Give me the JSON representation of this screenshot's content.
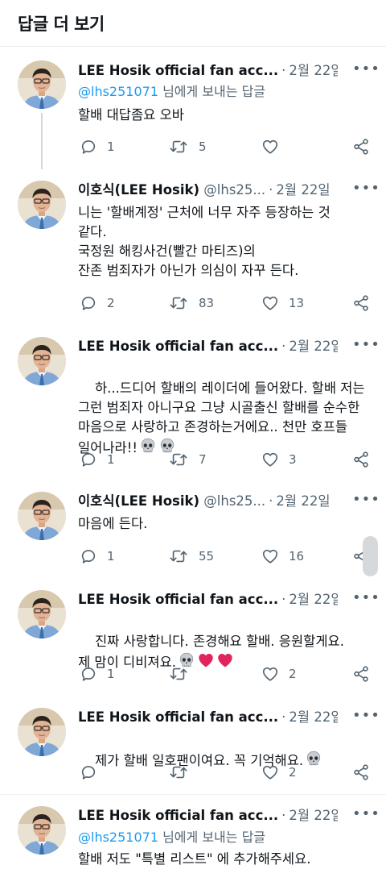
{
  "header": {
    "title": "답글 더 보기"
  },
  "tweets": [
    {
      "name": "LEE Hosik official fan acc...",
      "handle": "",
      "date": "2월 22일",
      "replying_handle": "@lhs251071",
      "replying_suffix": " 님에게 보내는 답글",
      "text": "할배 대답좀요 오바",
      "replies": "1",
      "retweets": "5",
      "likes": ""
    },
    {
      "name": "이호식(LEE Hosik)",
      "handle": "@lhs25...",
      "date": "2월 22일",
      "text": "니는 '할배계정' 근처에 너무 자주 등장하는 것 같다.\n국정원 해킹사건(빨간 마티즈)의\n잔존 범죄자가 아닌가 의심이 자꾸 든다.",
      "replies": "2",
      "retweets": "83",
      "likes": "13"
    },
    {
      "name": "LEE Hosik official fan acc...",
      "handle": "",
      "date": "2월 22일",
      "text": "하...드디어 할배의 레이더에 들어왔다. 할배 저는 그런 범죄자 아니구요 그냥 시골출신 할배를 순수한 마음으로 사랑하고 존경하는거에요.. 천만 호프들 일어나라!!",
      "replies": "1",
      "retweets": "7",
      "likes": "3"
    },
    {
      "name": "이호식(LEE Hosik)",
      "handle": "@lhs25...",
      "date": "2월 22일",
      "text": "마음에 든다.",
      "replies": "1",
      "retweets": "55",
      "likes": "16"
    },
    {
      "name": "LEE Hosik official fan acc...",
      "handle": "",
      "date": "2월 22일",
      "text": "진짜 사랑합니다. 존경해요 할배. 응원할게요. 제 맘이 디비져요.",
      "replies": "1",
      "retweets": "",
      "likes": "2"
    },
    {
      "name": "LEE Hosik official fan acc...",
      "handle": "",
      "date": "2월 22일",
      "text": "제가 할배 일호팬이여요. 꼭 기억해요.",
      "replies": "",
      "retweets": "",
      "likes": "2"
    },
    {
      "name": "LEE Hosik official fan acc...",
      "handle": "",
      "date": "2월 22일",
      "replying_handle": "@lhs251071",
      "replying_suffix": " 님에게 보내는 답글",
      "text": "할배 저도 \"특별 리스트\" 에 추가해주세요.",
      "replies": "",
      "retweets": "",
      "likes": ""
    }
  ],
  "icons": {
    "more": "more-icon",
    "reply": "reply-icon",
    "retweet": "retweet-icon",
    "like": "like-icon",
    "share": "share-icon",
    "skull": "skull-emoji",
    "heart": "heart-emoji"
  },
  "colors": {
    "accent": "#1d9bf0",
    "muted": "#536471",
    "text": "#0f1419",
    "heart": "#e0245e"
  }
}
